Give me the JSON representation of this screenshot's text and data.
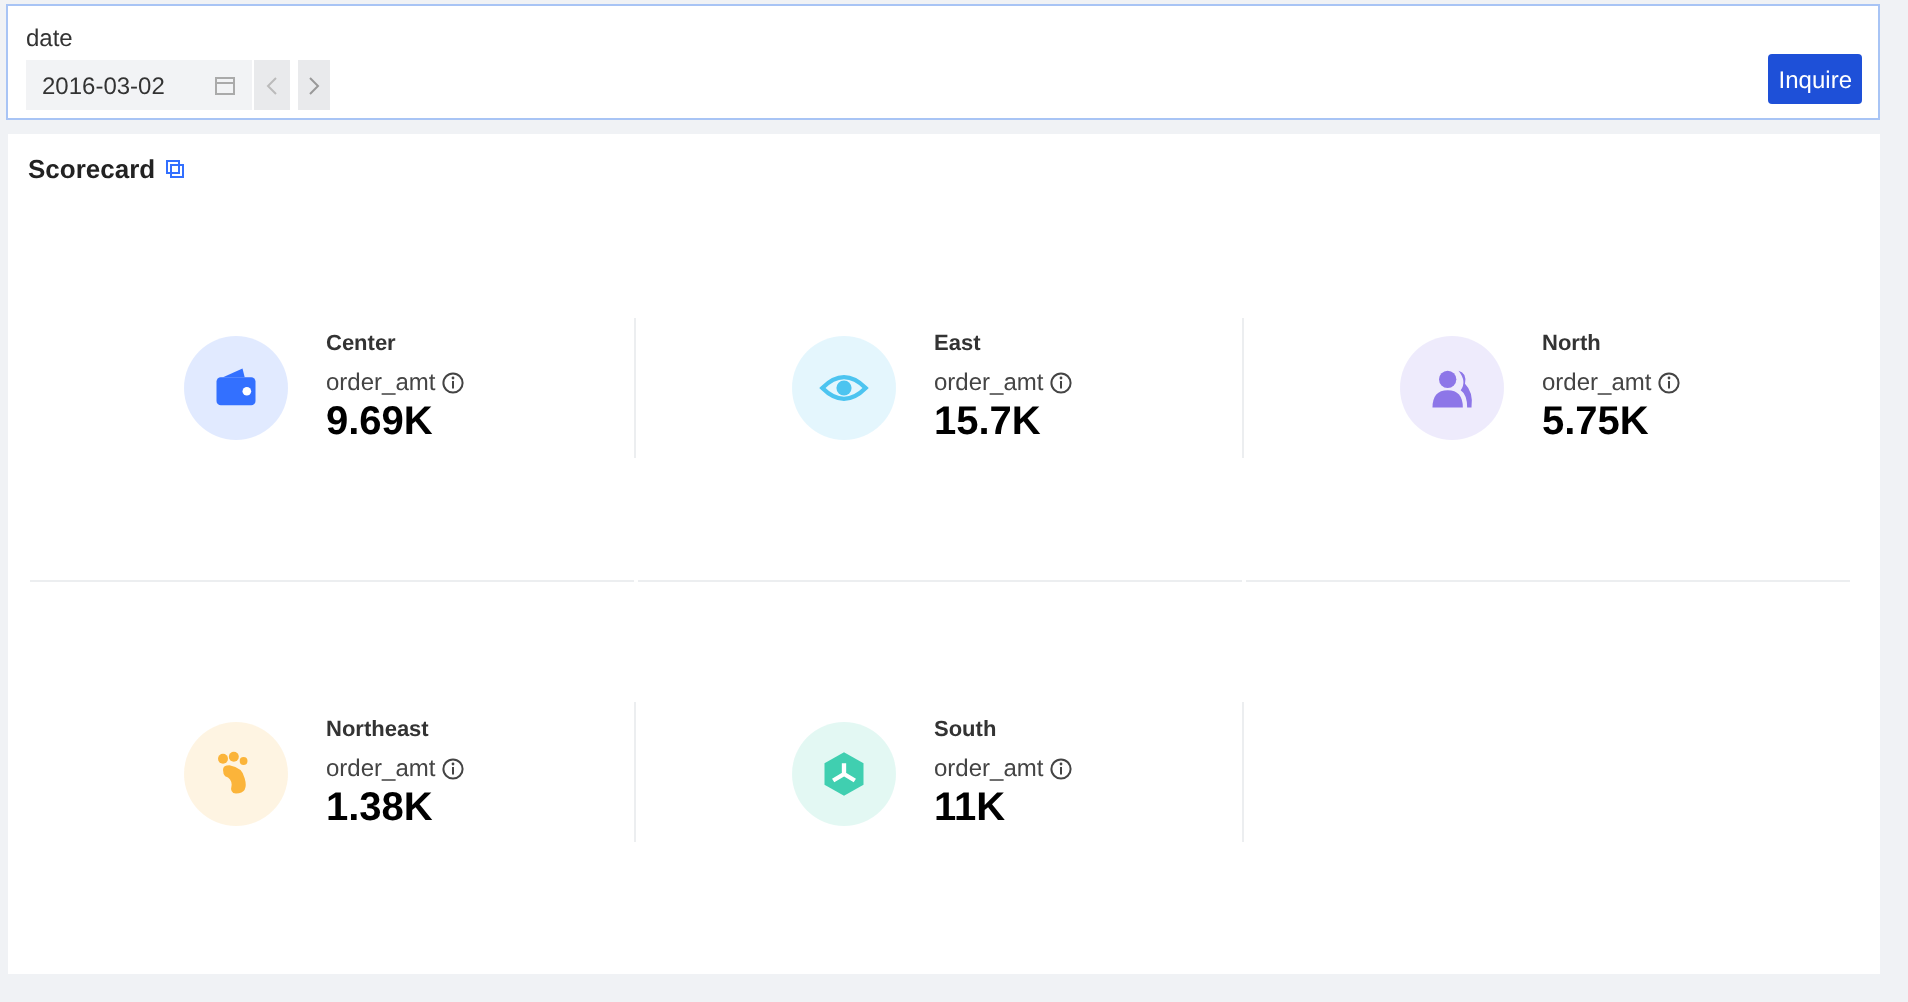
{
  "filter": {
    "label": "date",
    "date": "2016-03-02",
    "button": "Inquire"
  },
  "scorecard": {
    "title": "Scorecard",
    "items": [
      {
        "name": "Center",
        "metric": "order_amt",
        "value": "9.69K",
        "kind": "wallet",
        "color": "#3370ff"
      },
      {
        "name": "East",
        "metric": "order_amt",
        "value": "15.7K",
        "kind": "eye",
        "color": "#4cc4f0"
      },
      {
        "name": "North",
        "metric": "order_amt",
        "value": "5.75K",
        "kind": "people",
        "color": "#8d76e8"
      },
      {
        "name": "Northeast",
        "metric": "order_amt",
        "value": "1.38K",
        "kind": "foot",
        "color": "#fbb43a"
      },
      {
        "name": "South",
        "metric": "order_amt",
        "value": "11K",
        "kind": "cube",
        "color": "#40cfb0"
      }
    ]
  }
}
